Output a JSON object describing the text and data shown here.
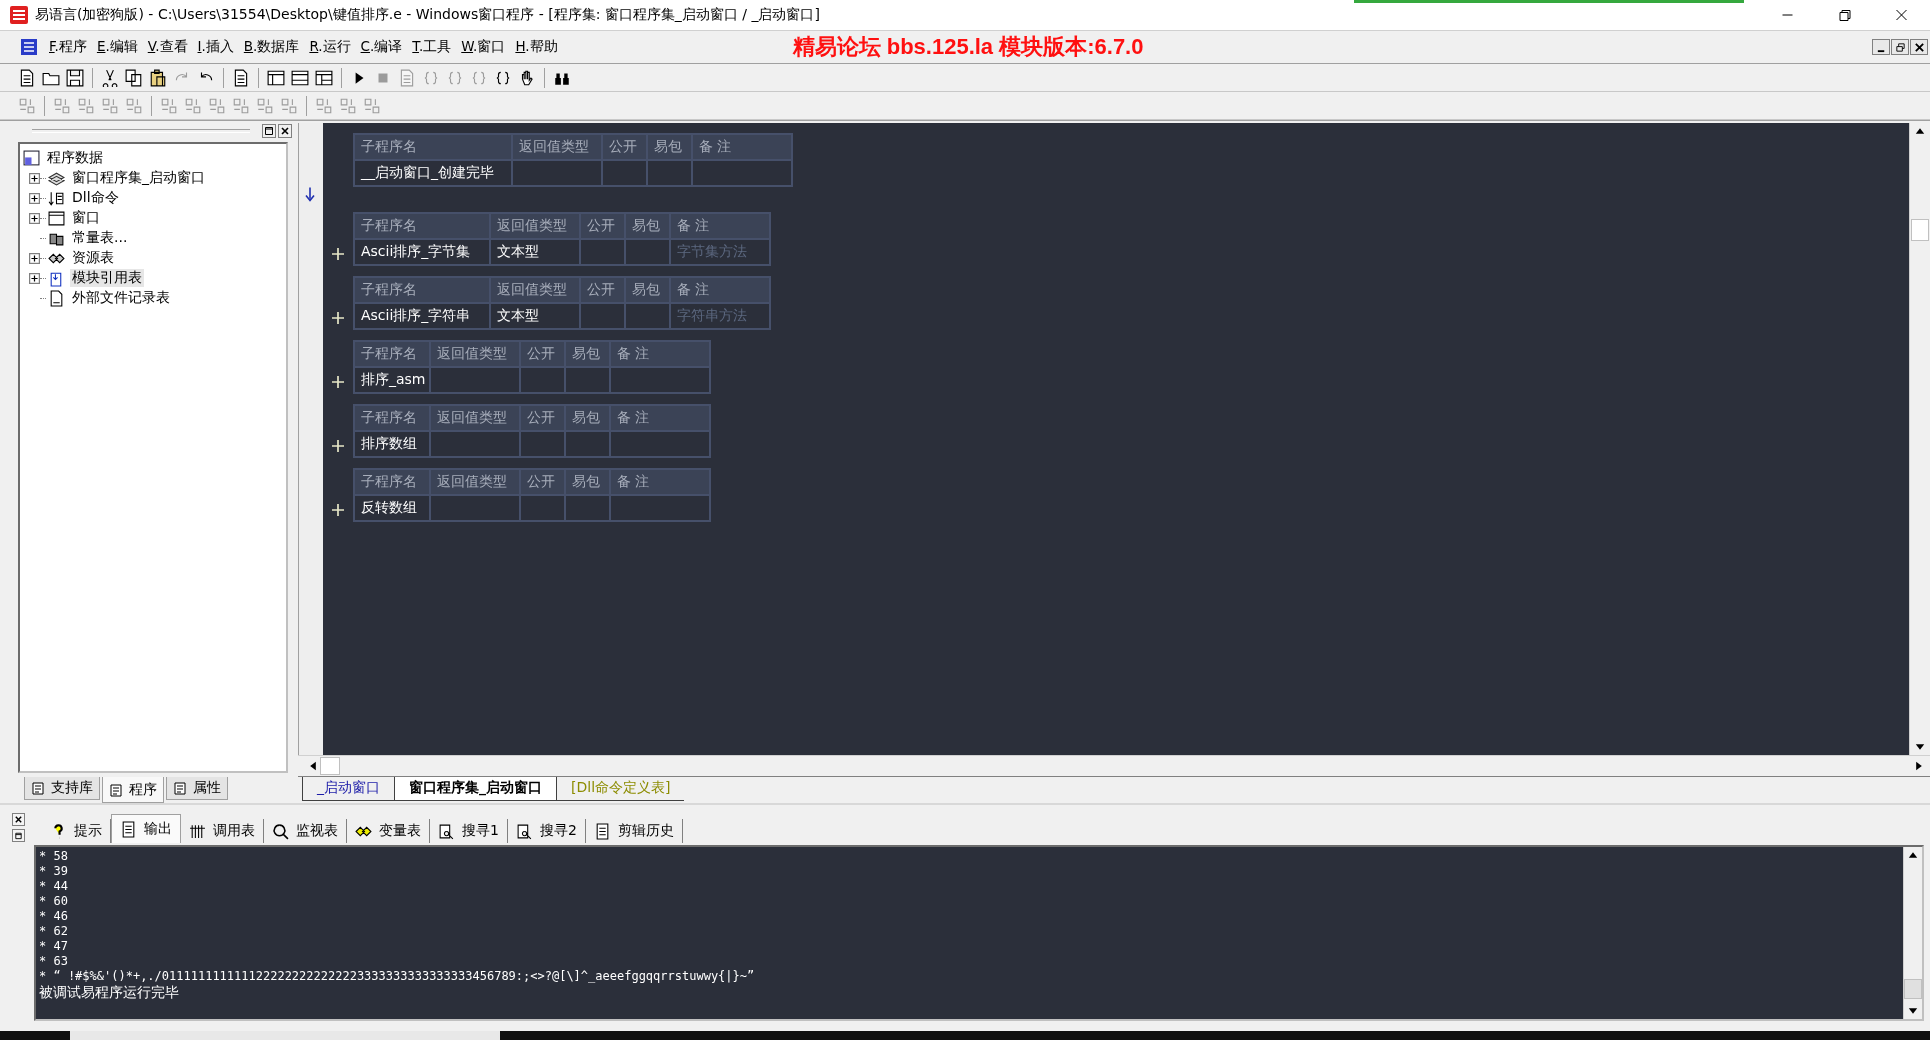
{
  "title_bar": {
    "title": "易语言(加密狗版) - C:\\Users\\31554\\Desktop\\键值排序.e - Windows窗口程序 - [程序集: 窗口程序集_启动窗口 / _启动窗口]"
  },
  "menu": [
    {
      "key": "F",
      "label": ".程序"
    },
    {
      "key": "E",
      "label": ".编辑"
    },
    {
      "key": "V",
      "label": ".查看"
    },
    {
      "key": "I",
      "label": ".插入"
    },
    {
      "key": "B",
      "label": ".数据库"
    },
    {
      "key": "R",
      "label": ".运行"
    },
    {
      "key": "C",
      "label": ".编译"
    },
    {
      "key": "T",
      "label": ".工具"
    },
    {
      "key": "W",
      "label": ".窗口"
    },
    {
      "key": "H",
      "label": ".帮助"
    }
  ],
  "banner": "精易论坛 bbs.125.la 模块版本:6.7.0",
  "tree": {
    "label": "程序数据",
    "children": [
      {
        "label": "窗口程序集_启动窗口",
        "kind": "folder",
        "selected": false
      },
      {
        "label": "Dll命令",
        "kind": "folder",
        "selected": false
      },
      {
        "label": "窗口",
        "kind": "folder",
        "selected": false
      },
      {
        "label": "常量表...",
        "kind": "leaf",
        "selected": false
      },
      {
        "label": "资源表",
        "kind": "folder",
        "selected": false
      },
      {
        "label": "模块引用表",
        "kind": "folder",
        "selected": true
      },
      {
        "label": "外部文件记录表",
        "kind": "leaf",
        "selected": false
      }
    ]
  },
  "left_tabs": [
    {
      "label": "支持库",
      "selected": false
    },
    {
      "label": "程序",
      "selected": true
    },
    {
      "label": "属性",
      "selected": false
    }
  ],
  "subroutines": [
    {
      "columns": [
        "子程序名",
        "返回值类型",
        "公开",
        "易包",
        "备 注"
      ],
      "name": "__启动窗口_创建完毕",
      "folded": false
    },
    {
      "columns": [
        "子程序名",
        "返回值类型",
        "公开",
        "易包",
        "备 注"
      ],
      "name": "Ascii排序_字节集",
      "return_type": "文本型",
      "comment": "字节集方法",
      "folded": true
    },
    {
      "columns": [
        "子程序名",
        "返回值类型",
        "公开",
        "易包",
        "备 注"
      ],
      "name": "Ascii排序_字符串",
      "return_type": "文本型",
      "comment": "字符串方法",
      "folded": true
    },
    {
      "columns": [
        "子程序名",
        "返回值类型",
        "公开",
        "易包",
        "备 注"
      ],
      "name": "排序_asm",
      "folded": true
    },
    {
      "columns": [
        "子程序名",
        "返回值类型",
        "公开",
        "易包",
        "备 注"
      ],
      "name": "排序数组",
      "folded": true
    },
    {
      "columns": [
        "子程序名",
        "返回值类型",
        "公开",
        "易包",
        "备 注"
      ],
      "name": "反转数组",
      "folded": true
    }
  ],
  "editor_tabs": [
    {
      "label": "_启动窗口",
      "selected": false,
      "color": "#1c1ca8"
    },
    {
      "label": "窗口程序集_启动窗口",
      "selected": true,
      "color": "#000000"
    },
    {
      "label": "[Dll命令定义表]",
      "selected": false,
      "color": "#8c8c00"
    }
  ],
  "output_tabs": [
    {
      "label": "提示",
      "selected": false
    },
    {
      "label": "输出",
      "selected": true
    },
    {
      "label": "调用表",
      "selected": false
    },
    {
      "label": "监视表",
      "selected": false
    },
    {
      "label": "变量表",
      "selected": false
    },
    {
      "label": "搜寻1",
      "selected": false
    },
    {
      "label": "搜寻2",
      "selected": false
    },
    {
      "label": "剪辑历史",
      "selected": false
    }
  ],
  "output_lines": [
    "* 58",
    "* 39",
    "* 44",
    "* 60",
    "* 46",
    "* 62",
    "* 47",
    "* 63",
    "* “ !#$%&'()*+,./0111111111111222222222222223333333333333333456789:;<>?@[\\]^_aeeefggqqrrstuwwy{|}~”",
    "被调试易程序运行完毕"
  ]
}
